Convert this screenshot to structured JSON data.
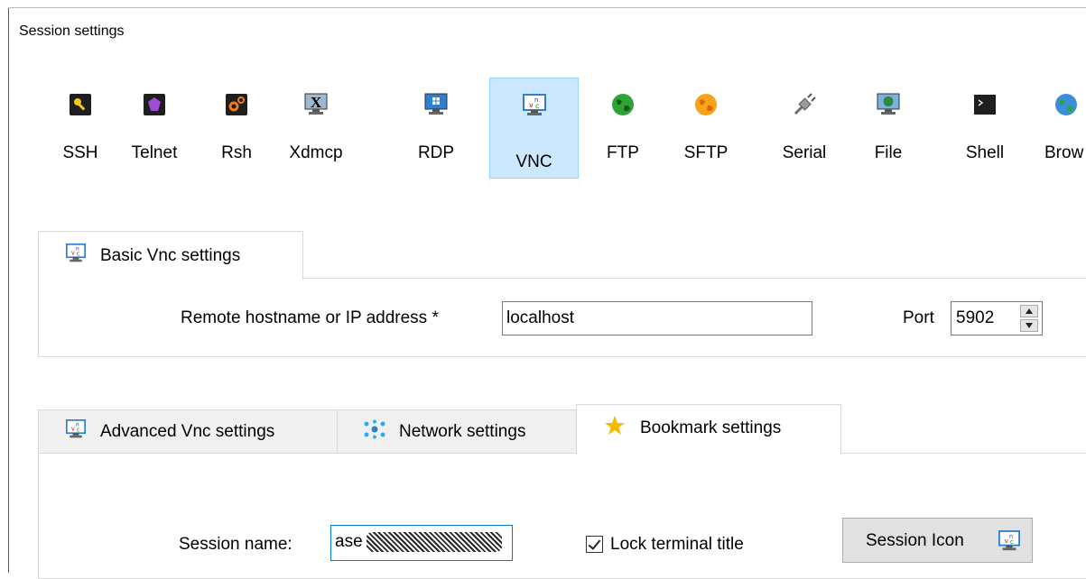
{
  "window": {
    "title": "Session settings"
  },
  "protocols": [
    {
      "label": "SSH",
      "icon": "key-icon"
    },
    {
      "label": "Telnet",
      "icon": "purple-gem-icon"
    },
    {
      "label": "Rsh",
      "icon": "gears-icon"
    },
    {
      "label": "Xdmcp",
      "icon": "x-monitor-icon"
    },
    {
      "label": "RDP",
      "icon": "windows-monitor-icon"
    },
    {
      "label": "VNC",
      "icon": "vnc-monitor-icon",
      "selected": true
    },
    {
      "label": "FTP",
      "icon": "green-globe-icon"
    },
    {
      "label": "SFTP",
      "icon": "orange-globe-icon"
    },
    {
      "label": "Serial",
      "icon": "plug-icon"
    },
    {
      "label": "File",
      "icon": "globe-monitor-icon"
    },
    {
      "label": "Shell",
      "icon": "terminal-icon"
    },
    {
      "label": "Brow",
      "icon": "blue-globe-icon"
    }
  ],
  "basic": {
    "tab_label": "Basic Vnc settings",
    "hostname_label": "Remote hostname or IP address *",
    "hostname_value": "localhost",
    "port_label": "Port",
    "port_value": "5902"
  },
  "lower_tabs": [
    {
      "label": "Advanced Vnc settings",
      "icon": "vnc-monitor-icon"
    },
    {
      "label": "Network settings",
      "icon": "network-icon"
    },
    {
      "label": "Bookmark settings",
      "icon": "star-icon",
      "active": true
    }
  ],
  "bookmark": {
    "session_name_label": "Session name:",
    "session_name_value": "ase",
    "lock_title_label": "Lock terminal title",
    "lock_title_checked": true,
    "session_icon_label": "Session Icon"
  },
  "colors": {
    "selected_bg": "#cce8ff",
    "selected_border": "#99d1ff",
    "focus_border": "#0078d7",
    "star": "#f5b900"
  }
}
